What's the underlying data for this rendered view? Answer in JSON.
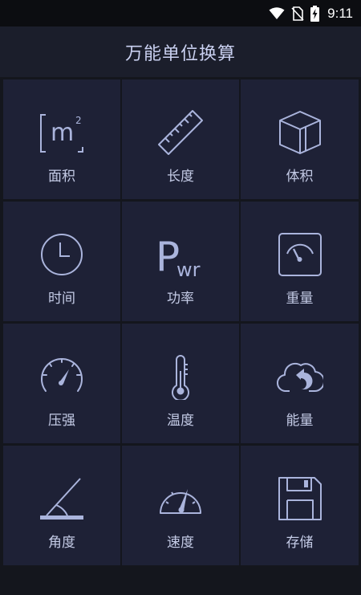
{
  "status_bar": {
    "time": "9:11",
    "icons": [
      "wifi-icon",
      "no-sim-icon",
      "battery-charging-icon"
    ]
  },
  "header": {
    "title": "万能单位换算"
  },
  "tiles": [
    {
      "label": "面积",
      "icon": "area-icon"
    },
    {
      "label": "长度",
      "icon": "ruler-icon"
    },
    {
      "label": "体积",
      "icon": "cube-icon"
    },
    {
      "label": "时间",
      "icon": "clock-icon"
    },
    {
      "label": "功率",
      "icon": "power-icon",
      "icon_text": "P",
      "icon_subtext": "wr"
    },
    {
      "label": "重量",
      "icon": "scale-icon"
    },
    {
      "label": "压强",
      "icon": "pressure-gauge-icon"
    },
    {
      "label": "温度",
      "icon": "thermometer-icon"
    },
    {
      "label": "能量",
      "icon": "energy-icon"
    },
    {
      "label": "角度",
      "icon": "angle-icon"
    },
    {
      "label": "速度",
      "icon": "speedometer-icon"
    },
    {
      "label": "存储",
      "icon": "floppy-disk-icon"
    }
  ],
  "area_icon": {
    "base": "m",
    "exponent": "2"
  },
  "colors": {
    "background": "#14161d",
    "header": "#1b1e2b",
    "tile": "#1e2136",
    "icon_stroke": "#aab4dc",
    "text": "#c4cbe6"
  }
}
